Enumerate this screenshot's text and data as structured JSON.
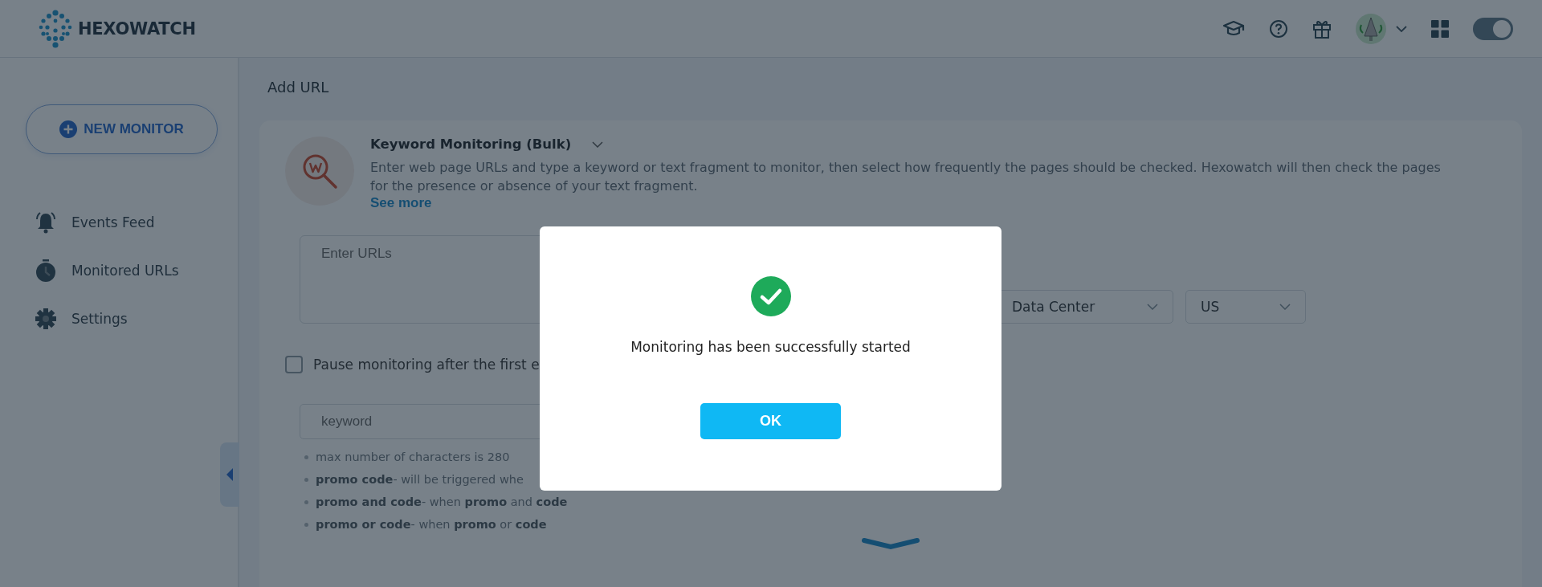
{
  "header": {
    "logo_text": "HEXOWATCH",
    "theme_toggle": {
      "on": true
    }
  },
  "sidebar": {
    "new_button": "NEW MONITOR",
    "items": [
      {
        "kind": "bell",
        "label": "Events Feed"
      },
      {
        "kind": "timer",
        "label": "Monitored URLs"
      },
      {
        "kind": "gear",
        "label": "Settings"
      }
    ]
  },
  "page_title": "Add URL",
  "tool": {
    "title": "Keyword Monitoring (Bulk)",
    "description": "Enter web page URLs and type a keyword or text fragment to monitor, then select how frequently the pages should be checked. Hexowatch will then check the pages for the presence or absence of your text fragment.",
    "see_more": "See more"
  },
  "urls_field": {
    "placeholder": "Enter URLs"
  },
  "selects": [
    {
      "value": "Data Center"
    },
    {
      "value": "US"
    }
  ],
  "pause_option": {
    "label": "Pause monitoring after the first e",
    "checked": false
  },
  "keyword_field": {
    "placeholder": "keyword"
  },
  "hints": [
    "max number of characters is 280",
    "**promo code**- will be triggered whe",
    "**promo and code**- when  **promo** and  **code**",
    "**promo or code**- when  **promo** or **code**"
  ],
  "dialog": {
    "message": "Monitoring has been successfully started",
    "button": "OK"
  }
}
